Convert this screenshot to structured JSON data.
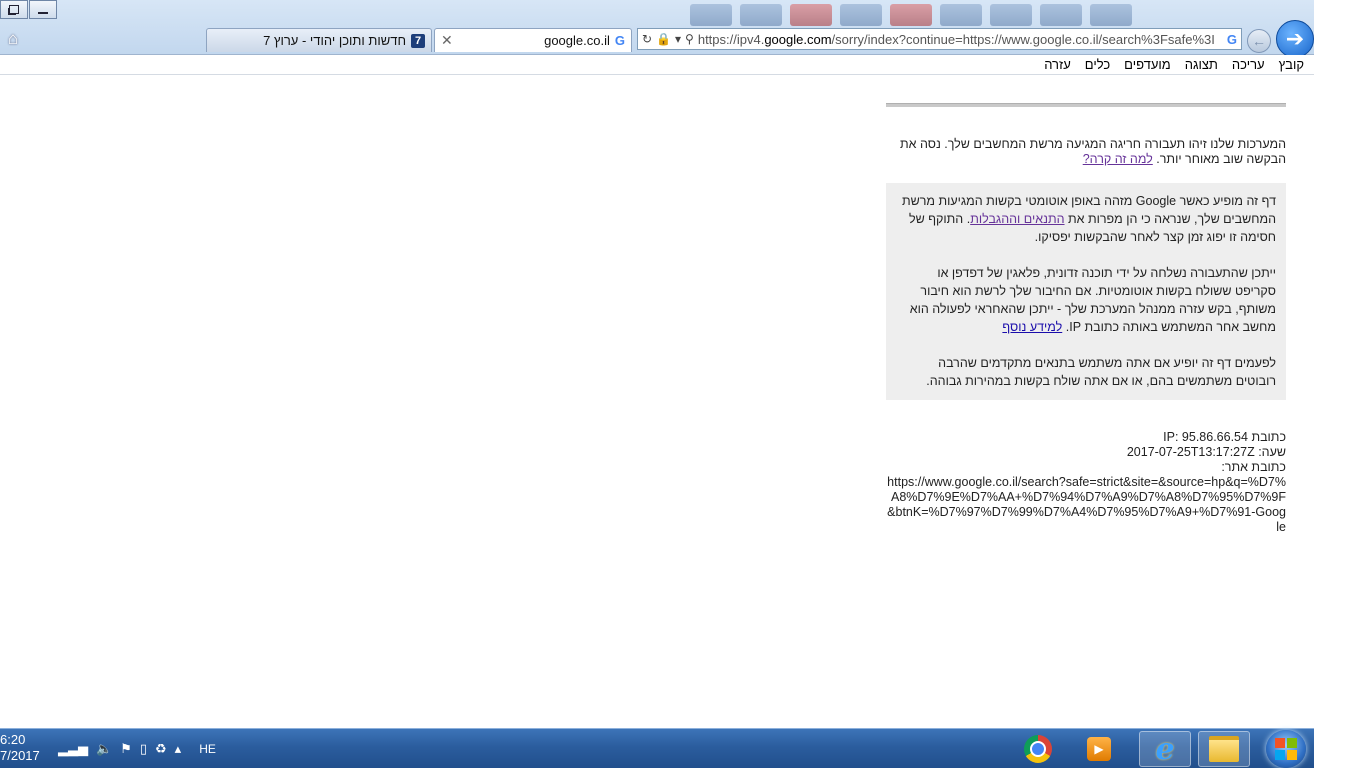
{
  "browser": {
    "tabs": [
      {
        "label": "חדשות ותוכן יהודי - ערוץ 7",
        "icon": "7",
        "active": false
      },
      {
        "label": "google.co.il",
        "icon": "G",
        "active": true
      }
    ],
    "address_bar": {
      "url_prefix": "https://ipv4.",
      "url_domain": "google.com",
      "url_rest": "/sorry/index?continue=https://www.google.co.il/search%3Fsafe%3I",
      "search_provider_icon": "G"
    }
  },
  "menu": [
    "קובץ",
    "עריכה",
    "תצוגה",
    "מועדפים",
    "כלים",
    "עזרה"
  ],
  "page": {
    "intro_text": "המערכות שלנו זיהו תעבורה חריגה המגיעה מרשת המחשבים שלך. נסה את הבקשה שוב מאוחר יותר.",
    "intro_link": "למה זה קרה?",
    "box": {
      "p1_before": "דף זה מופיע כאשר Google מזהה באופן אוטומטי בקשות המגיעות מרשת המחשבים שלך, שנראה כי הן מפרות את",
      "p1_link": "התנאים וההגבלות",
      "p1_after": ". התוקף של חסימה זו יפוג זמן קצר לאחר שהבקשות יפסיקו.",
      "p2_before": "ייתכן שהתעבורה נשלחה על ידי תוכנה זדונית, פלאגין של דפדפן או סקריפט ששולח בקשות אוטומטיות. אם החיבור שלך לרשת הוא חיבור משותף, בקש עזרה ממנהל המערכת שלך - ייתכן שהאחראי לפעולה הוא מחשב אחר המשתמש באותה כתובת IP.",
      "p2_link": "למידע נוסף",
      "p3": "לפעמים דף זה יופיע אם אתה משתמש בתנאים מתקדמים שהרבה רובוטים משתמשים בהם, או אם אתה שולח בקשות במהירות גבוהה."
    },
    "ip_label": "כתובת IP:",
    "ip_value": "95.86.66.54",
    "time_label": "שעה:",
    "time_value": "2017-07-25T13:17:27Z",
    "url_label": "כתובת אתר:",
    "url_value": "https://www.google.co.il/search?safe=strict&site=&source=hp&q=%D7%A8%D7%9E%D7%AA+%D7%94%D7%A9%D7%A8%D7%95%D7%9F&btnK=%D7%97%D7%99%D7%A4%D7%95%D7%A9+%D7%91-Google"
  },
  "taskbar": {
    "clock_time": "6:20",
    "clock_date": "7/2017",
    "language": "HE",
    "pinned_apps": [
      "chrome-icon",
      "media-player-icon",
      "internet-explorer-icon",
      "file-explorer-icon"
    ]
  },
  "colors": {
    "visited_link": "#663399",
    "link": "#1a0dab",
    "box_bg": "#eeeeee",
    "taskbar": "#2b5d9e"
  }
}
